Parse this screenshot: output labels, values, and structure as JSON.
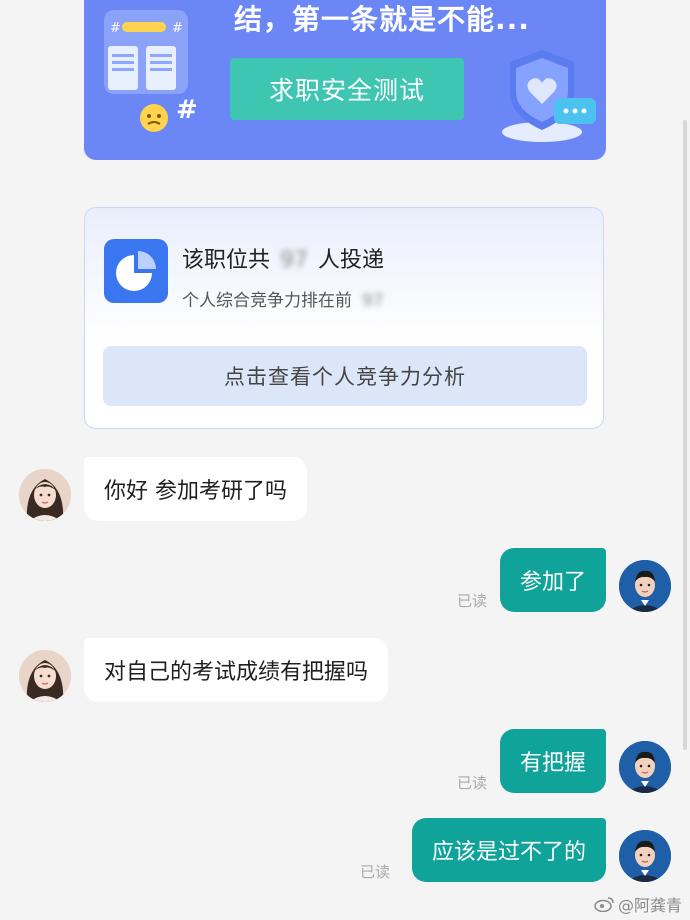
{
  "banner": {
    "headline": "结，第一条就是不能...",
    "button_label": "求职安全测试",
    "bg_color": "#6b86f5",
    "button_color": "#3ec6b3"
  },
  "competition": {
    "line1_prefix": "该职位共",
    "line1_count": "97",
    "line1_suffix": "人投递",
    "line2_prefix": "个人综合竞争力排在前",
    "line2_rank": "97",
    "button_label": "点击查看个人竞争力分析",
    "icon": "pie-chart-icon"
  },
  "messages": [
    {
      "from": "other",
      "text": "你好 参加考研了吗"
    },
    {
      "from": "me",
      "text": "参加了",
      "status": "已读"
    },
    {
      "from": "other",
      "text": "对自己的考试成绩有把握吗"
    },
    {
      "from": "me",
      "text": "有把握",
      "status": "已读"
    },
    {
      "from": "me",
      "text": "应该是过不了的",
      "status": "已读"
    }
  ],
  "watermark": "@阿龚青",
  "colors": {
    "outgoing_bubble": "#0fa39a",
    "incoming_bubble": "#ffffff",
    "background": "#f4f4f5"
  }
}
